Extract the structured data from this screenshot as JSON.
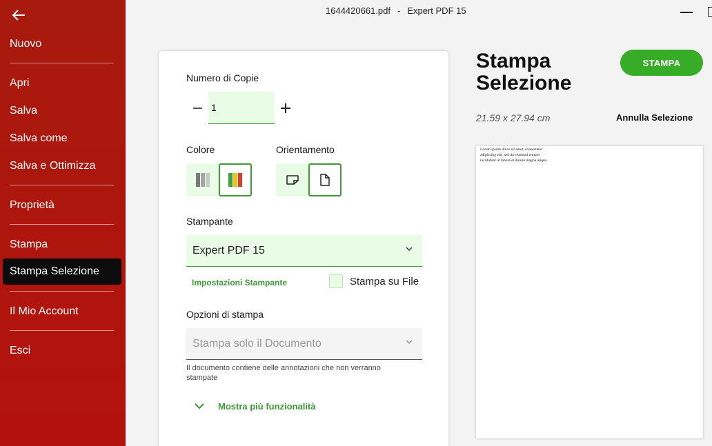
{
  "window": {
    "filename": "1644420661.pdf",
    "separator": "-",
    "app_name": "Expert PDF 15"
  },
  "sidebar": {
    "items": [
      {
        "label": "Nuovo"
      },
      {
        "label": "Apri"
      },
      {
        "label": "Salva"
      },
      {
        "label": "Salva come"
      },
      {
        "label": "Salva e Ottimizza"
      },
      {
        "label": "Proprietà"
      },
      {
        "label": "Stampa"
      },
      {
        "label": "Stampa Selezione",
        "active": true
      },
      {
        "label": "Il Mio Account"
      },
      {
        "label": "Esci"
      }
    ]
  },
  "panel": {
    "copies_label": "Numero di Copie",
    "copies_value": "1",
    "color_label": "Colore",
    "orientation_label": "Orientamento",
    "printer_label": "Stampante",
    "printer_value": "Expert PDF 15",
    "printer_settings_link": "Impostazioni Stampante",
    "print_to_file_label": "Stampa su File",
    "print_to_file_checked": false,
    "options_label": "Opzioni di stampa",
    "options_value": "Stampa solo il Documento",
    "options_note": "Il documento contiene delle annotazioni che non verranno stampate",
    "more_features_link": "Mostra più funzionalità"
  },
  "main": {
    "title": "Stampa Selezione",
    "print_button": "STAMPA",
    "page_size": "21.59 x 27.94 cm",
    "cancel_selection": "Annulla Selezione",
    "preview_text": "Lorem ipsum dolor sit amet, consectetur adipiscing elit, sed do eiusmod tempor incididunt ut labore et dolore magna aliqua."
  },
  "colors": {
    "sidebar_bg": "#b3120c",
    "accent_green": "#37ad27",
    "field_bg": "#e9fce5",
    "active_item_bg": "#0c0c0c"
  },
  "icons": {
    "back": "arrow-left-icon",
    "grayscale": "grayscale-bars-icon",
    "color": "color-bars-icon",
    "landscape": "landscape-page-icon",
    "portrait": "portrait-page-icon",
    "dropdown": "chevron-down-icon"
  }
}
